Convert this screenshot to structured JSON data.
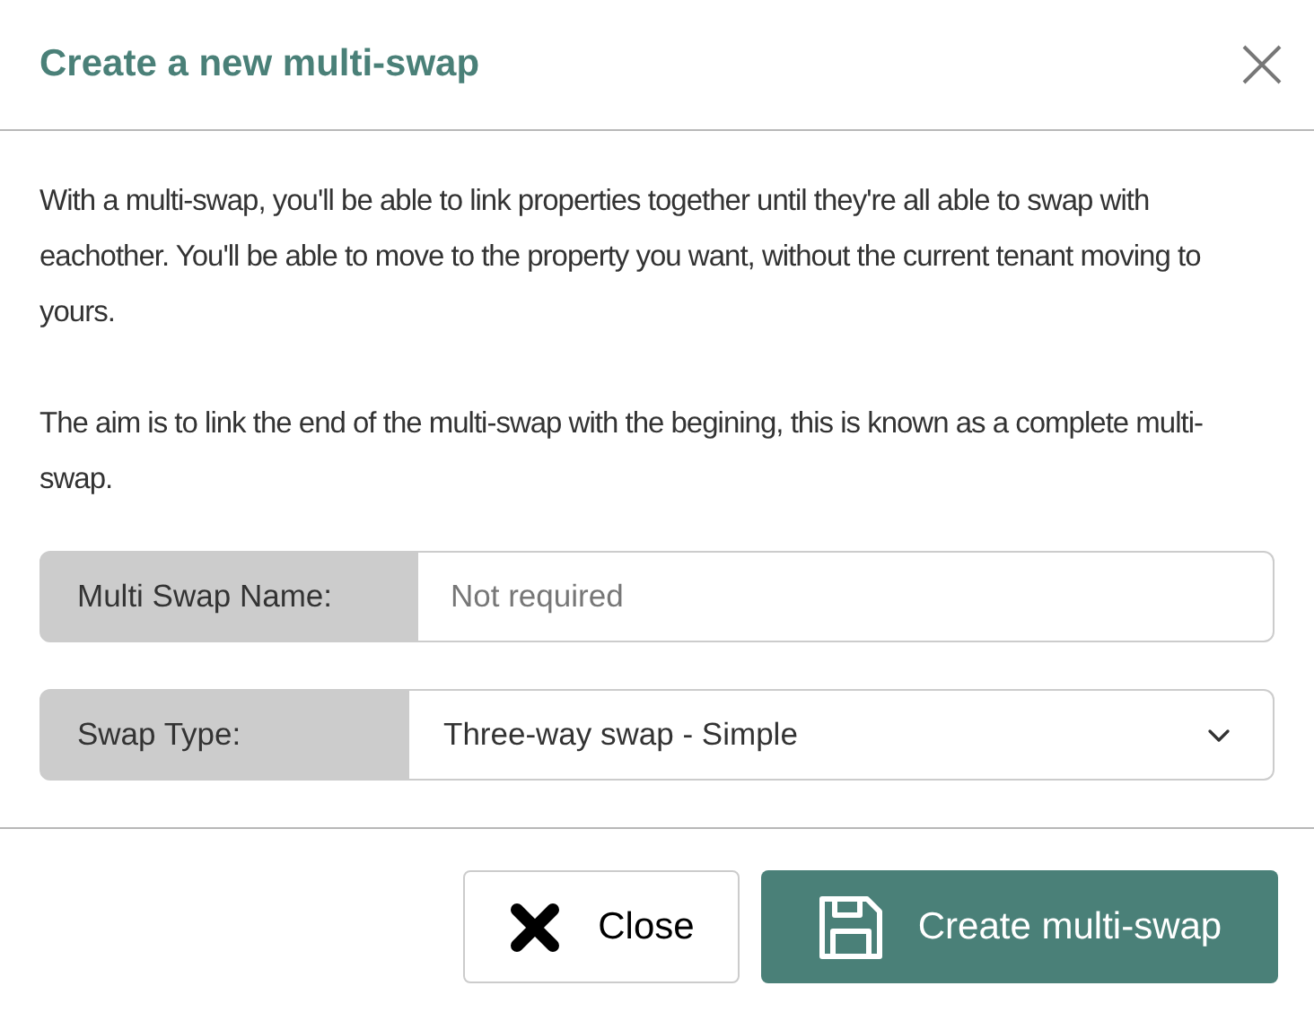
{
  "dialog": {
    "title": "Create a new multi-swap"
  },
  "paragraphs": [
    "With a multi-swap, you'll be able to link properties together until they're all able to swap with eachother. You'll be able to move to the property you want, without the current tenant moving to yours.",
    "The aim is to link the end of the multi-swap with the begining, this is known as a complete multi-swap."
  ],
  "fields": [
    {
      "kind": "input",
      "label": "Multi Swap Name:",
      "placeholder": "Not required"
    },
    {
      "kind": "select",
      "label": "Swap Type:",
      "value": "Three-way swap - Simple"
    }
  ],
  "buttons": [
    {
      "kind": "secondary",
      "label": "Close"
    },
    {
      "kind": "primary",
      "label": "Create multi-swap"
    }
  ]
}
